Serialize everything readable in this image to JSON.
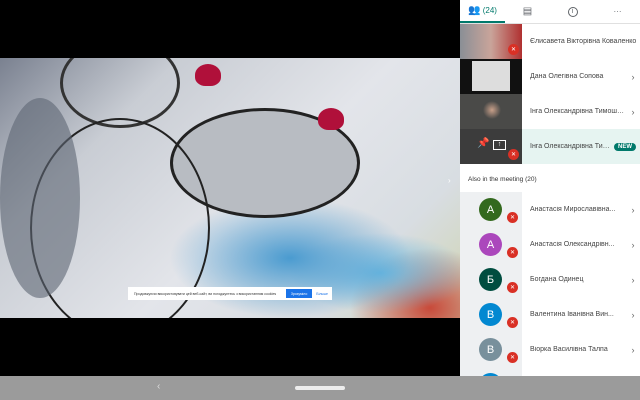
{
  "banner": {
    "text": "Продовжуючи використовувати цей веб-сайт, ви погоджуєтесь з використанням cookies",
    "accept": "Зрозуміло",
    "more": "Більше"
  },
  "tabs": {
    "people_count": "(24)",
    "people_icon": "people-icon",
    "chat_icon": "chat-icon",
    "info_icon": "info-icon",
    "more_icon": "more-icon"
  },
  "pinned": [
    {
      "name": "Єлисавета Вікторівна Коваленко",
      "mic": "off"
    },
    {
      "name": "Дана Олегівна Сопова",
      "mic": "on"
    },
    {
      "name": "Інга Олександрівна Тимошенко",
      "mic": "on"
    },
    {
      "name": "Інга Олександрівна Тимошенко",
      "mic": "off",
      "badge": "NEW",
      "presenting": true
    }
  ],
  "also_label": "Also in the meeting (20)",
  "attendees": [
    {
      "initial": "А",
      "name": "Анастасія Мирославівна...",
      "color": "#33691e"
    },
    {
      "initial": "А",
      "name": "Анастасія Олександрівн...",
      "color": "#ab47bc"
    },
    {
      "initial": "Б",
      "name": "Богдана Одинец",
      "color": "#004d40"
    },
    {
      "initial": "В",
      "name": "Валентина Іванівна Вин...",
      "color": "#0288d1"
    },
    {
      "initial": "В",
      "name": "Віорка Василівна Талпа",
      "color": "#78909c"
    },
    {
      "initial": "",
      "name": "",
      "color": "#0288d1"
    }
  ],
  "accent": "#00796b"
}
